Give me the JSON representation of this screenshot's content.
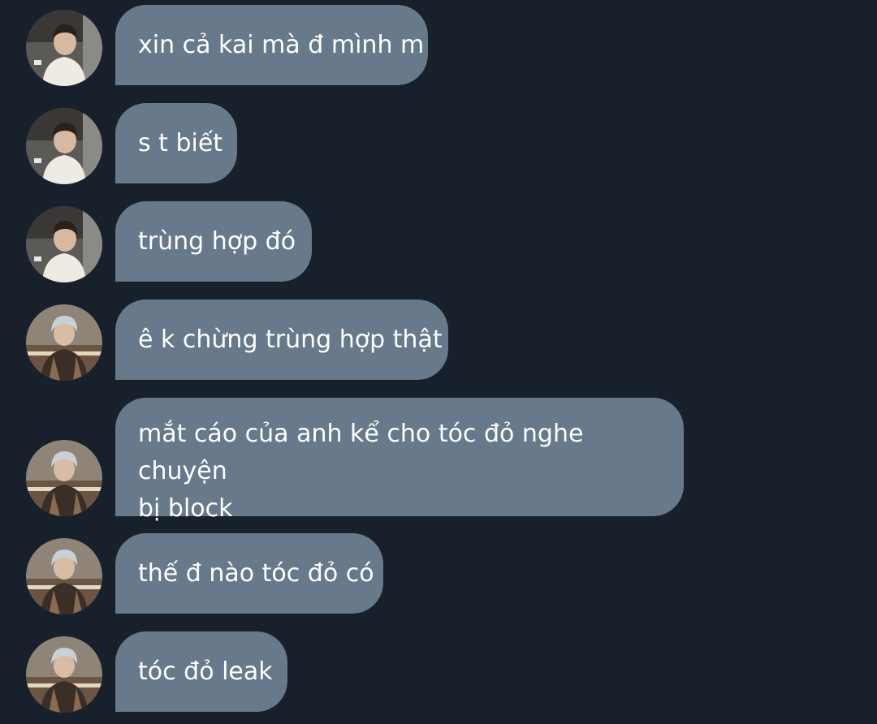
{
  "messages": [
    {
      "avatar": "avatar-a",
      "text": "xin cả kai mà đ mình m"
    },
    {
      "avatar": "avatar-a",
      "text": "s t biết"
    },
    {
      "avatar": "avatar-a",
      "text": "trùng hợp đó"
    },
    {
      "avatar": "avatar-b",
      "text": "ê k chừng trùng hợp thật"
    },
    {
      "avatar": "avatar-b",
      "lines": [
        "mắt cáo của anh kể cho tóc đỏ nghe chuyện",
        "bị block"
      ]
    },
    {
      "avatar": "avatar-b",
      "text": "thế đ nào tóc đỏ có"
    },
    {
      "avatar": "avatar-b",
      "text": "tóc đỏ leak"
    }
  ],
  "colors": {
    "background": "#17202b",
    "bubble": "#67798a",
    "text": "#ffffff"
  }
}
